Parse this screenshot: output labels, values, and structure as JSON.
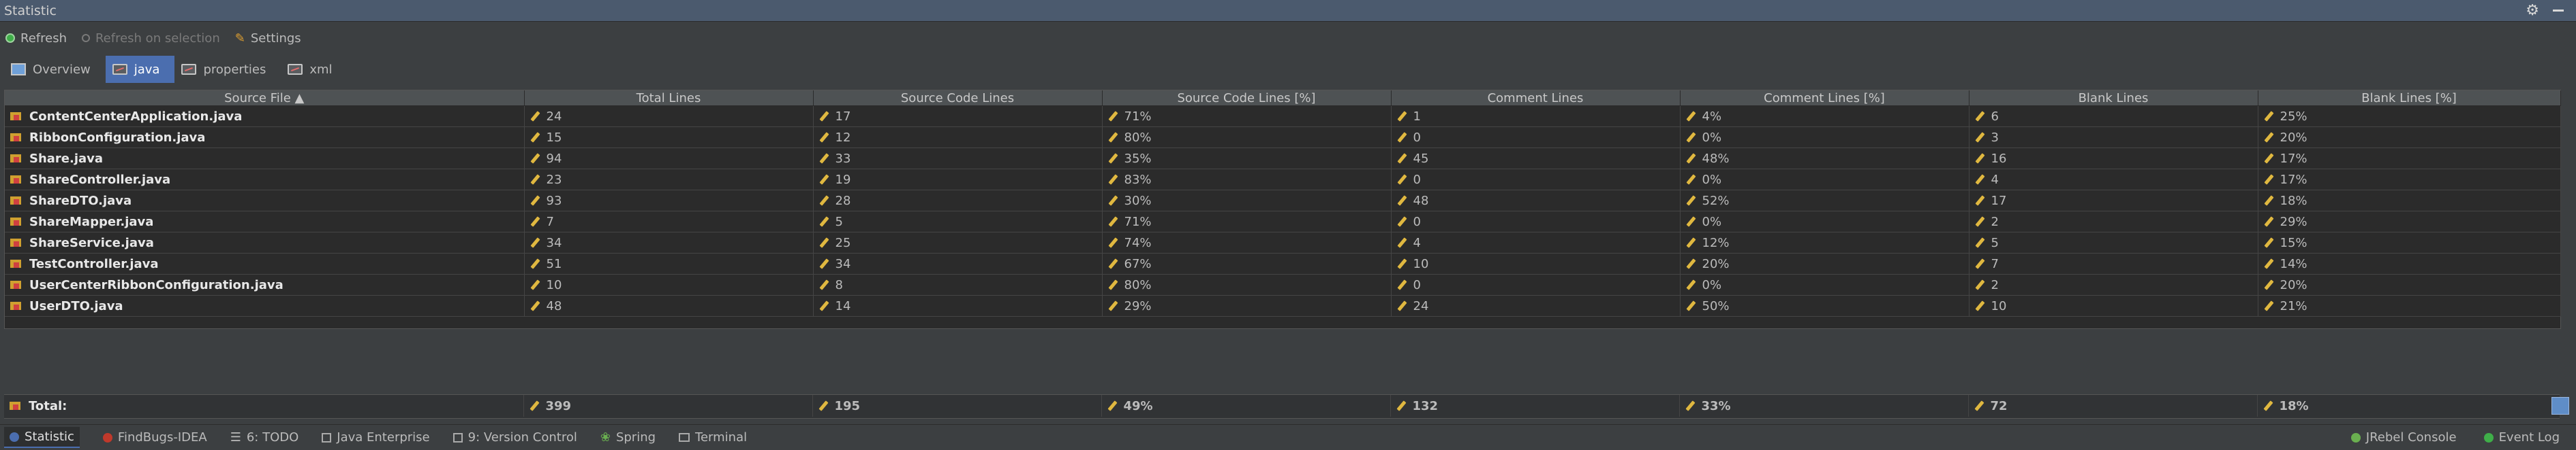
{
  "window": {
    "title": "Statistic"
  },
  "toolbar": {
    "refresh": "Refresh",
    "refresh_on_selection": "Refresh on selection",
    "settings": "Settings"
  },
  "tabs": [
    {
      "label": "Overview"
    },
    {
      "label": "java"
    },
    {
      "label": "properties"
    },
    {
      "label": "xml"
    }
  ],
  "table": {
    "headers": [
      "Source File ▲",
      "Total Lines",
      "Source Code Lines",
      "Source Code Lines [%]",
      "Comment Lines",
      "Comment Lines [%]",
      "Blank Lines",
      "Blank Lines [%]"
    ],
    "rows": [
      [
        "ContentCenterApplication.java",
        "24",
        "17",
        "71%",
        "1",
        "4%",
        "6",
        "25%"
      ],
      [
        "RibbonConfiguration.java",
        "15",
        "12",
        "80%",
        "0",
        "0%",
        "3",
        "20%"
      ],
      [
        "Share.java",
        "94",
        "33",
        "35%",
        "45",
        "48%",
        "16",
        "17%"
      ],
      [
        "ShareController.java",
        "23",
        "19",
        "83%",
        "0",
        "0%",
        "4",
        "17%"
      ],
      [
        "ShareDTO.java",
        "93",
        "28",
        "30%",
        "48",
        "52%",
        "17",
        "18%"
      ],
      [
        "ShareMapper.java",
        "7",
        "5",
        "71%",
        "0",
        "0%",
        "2",
        "29%"
      ],
      [
        "ShareService.java",
        "34",
        "25",
        "74%",
        "4",
        "12%",
        "5",
        "15%"
      ],
      [
        "TestController.java",
        "51",
        "34",
        "67%",
        "10",
        "20%",
        "7",
        "14%"
      ],
      [
        "UserCenterRibbonConfiguration.java",
        "10",
        "8",
        "80%",
        "0",
        "0%",
        "2",
        "20%"
      ],
      [
        "UserDTO.java",
        "48",
        "14",
        "29%",
        "24",
        "50%",
        "10",
        "21%"
      ]
    ],
    "total": [
      "Total:",
      "399",
      "195",
      "49%",
      "132",
      "33%",
      "72",
      "18%"
    ]
  },
  "statusbar": {
    "left": [
      "Statistic",
      "FindBugs-IDEA",
      "6: TODO",
      "Java Enterprise",
      "9: Version Control",
      "Spring",
      "Terminal"
    ],
    "right": [
      "JRebel Console",
      "Event Log"
    ]
  },
  "colors": {
    "accent": "#4b6eaf",
    "background": "#3c3f41",
    "table_bg": "#2b2b2b"
  }
}
